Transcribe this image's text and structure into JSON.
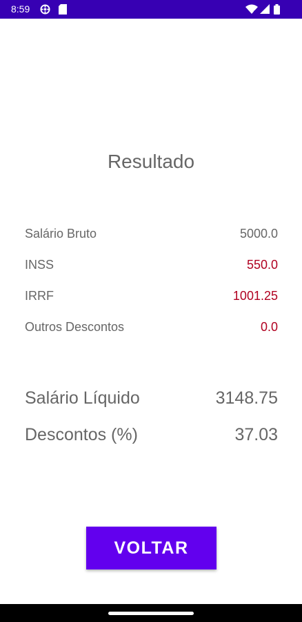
{
  "status_bar": {
    "time": "8:59",
    "icons": [
      "settings-icon",
      "sd-card-icon",
      "wifi-icon",
      "signal-icon",
      "battery-icon"
    ],
    "background": "#3700b3"
  },
  "title": "Resultado",
  "rows": [
    {
      "label": "Salário Bruto",
      "value": "5000.0",
      "value_color": "#666666"
    },
    {
      "label": "INSS",
      "value": "550.0",
      "value_color": "#b00020"
    },
    {
      "label": "IRRF",
      "value": "1001.25",
      "value_color": "#b00020"
    },
    {
      "label": "Outros Descontos",
      "value": "0.0",
      "value_color": "#b00020"
    }
  ],
  "summary": [
    {
      "label": "Salário Líquido",
      "value": "3148.75"
    },
    {
      "label": "Descontos (%)",
      "value": "37.03"
    }
  ],
  "button": {
    "label": "VOLTAR",
    "color": "#6200ee"
  }
}
